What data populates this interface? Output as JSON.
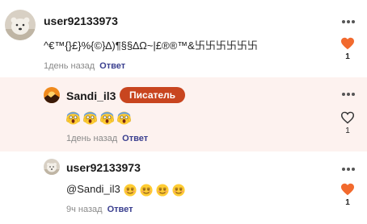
{
  "comments": [
    {
      "username": "user92133973",
      "text": "^€™{}£}%{©}∆)¶§§∆Ω~|£®®™&卐卐卐卐卐卐",
      "time": "1день назад",
      "reply_label": "Ответ",
      "likes": "1",
      "liked": true,
      "avatar_icon": "polar-bear-avatar"
    },
    {
      "username": "Sandi_il3",
      "badge": "Писатель",
      "emojis": [
        "screaming-face-emoji",
        "screaming-face-emoji",
        "screaming-face-emoji",
        "screaming-face-emoji"
      ],
      "time": "1день назад",
      "reply_label": "Ответ",
      "likes": "1",
      "liked": false,
      "avatar_icon": "sunset-avatar"
    },
    {
      "username": "user92133973",
      "text": "@Sandi_il3",
      "emojis": [
        "dizzy-face-emoji",
        "dizzy-face-emoji",
        "dizzy-face-emoji",
        "dizzy-face-emoji"
      ],
      "time": "9ч назад",
      "reply_label": "Ответ",
      "likes": "1",
      "liked": true,
      "avatar_icon": "polar-bear-avatar"
    }
  ],
  "colors": {
    "heart_filled": "#f26a2e",
    "badge": "#c8451f",
    "reply_link": "#3a3f8f",
    "highlight_bg": "#fdf2ef"
  }
}
